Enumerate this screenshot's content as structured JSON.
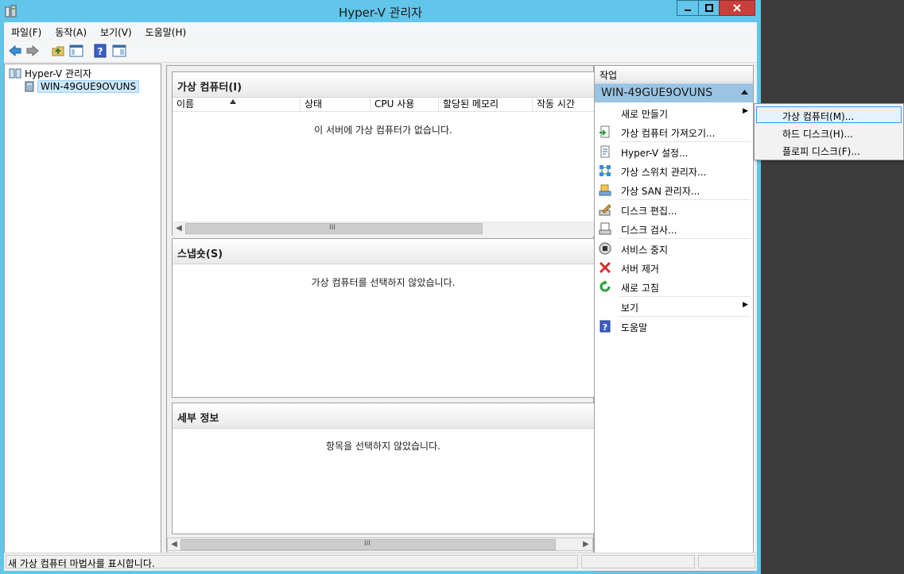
{
  "window": {
    "title": "Hyper-V 관리자"
  },
  "menubar": {
    "items": [
      "파일(F)",
      "동작(A)",
      "보기(V)",
      "도움말(H)"
    ]
  },
  "tree": {
    "root": "Hyper-V 관리자",
    "server": "WIN-49GUE9OVUNS"
  },
  "vm_section": {
    "title": "가상 컴퓨터(I)",
    "columns": [
      "이름",
      "상태",
      "CPU 사용",
      "할당된 메모리",
      "작동 시간"
    ],
    "empty": "이 서버에 가상 컴퓨터가 없습니다.",
    "scroll_grip": "III"
  },
  "snapshot_section": {
    "title": "스냅숏(S)",
    "empty": "가상 컴퓨터를 선택하지 않았습니다."
  },
  "detail_section": {
    "title": "세부 정보",
    "empty": "항목을 선택하지 않았습니다.",
    "scroll_grip": "III"
  },
  "actions": {
    "header": "작업",
    "server": "WIN-49GUE9OVUNS",
    "items": [
      {
        "label": "새로 만들기",
        "icon": "none",
        "submenu": true
      },
      {
        "label": "가상 컴퓨터 가져오기...",
        "icon": "import-icon"
      },
      {
        "label": "Hyper-V 설정...",
        "icon": "settings-icon"
      },
      {
        "label": "가상 스위치 관리자...",
        "icon": "switch-icon"
      },
      {
        "label": "가상 SAN 관리자...",
        "icon": "san-icon"
      },
      {
        "label": "디스크 편집...",
        "icon": "disk-edit-icon"
      },
      {
        "label": "디스크 검사...",
        "icon": "disk-inspect-icon"
      },
      {
        "label": "서비스 중지",
        "icon": "stop-icon"
      },
      {
        "label": "서버 제거",
        "icon": "remove-icon"
      },
      {
        "label": "새로 고침",
        "icon": "refresh-icon"
      },
      {
        "label": "보기",
        "icon": "none",
        "submenu": true
      },
      {
        "label": "도움말",
        "icon": "help-icon"
      }
    ]
  },
  "submenu": {
    "items": [
      "가상 컴퓨터(M)...",
      "하드 디스크(H)...",
      "플로피 디스크(F)..."
    ]
  },
  "status": {
    "text": "새 가상 컴퓨터 마법사를 표시합니다."
  }
}
